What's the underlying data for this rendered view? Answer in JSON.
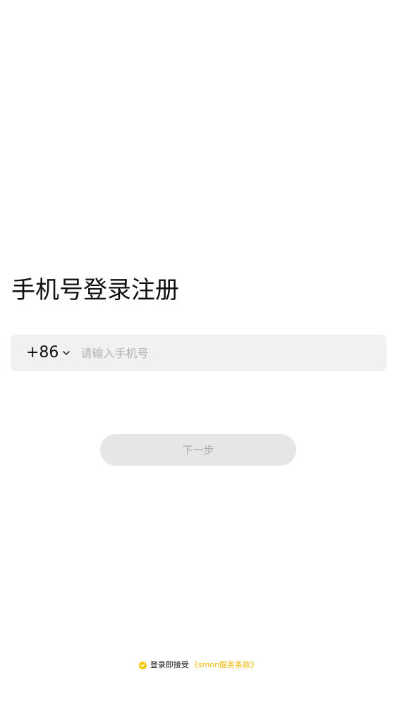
{
  "page": {
    "title": "手机号登录注册"
  },
  "phone": {
    "country_code": "+86",
    "chevron_icon": "chevron-down-icon",
    "placeholder": "请输入手机号",
    "value": ""
  },
  "actions": {
    "next_label": "下一步"
  },
  "agreement": {
    "check_icon": "check-circle-icon",
    "prefix": "登录即接受",
    "link_text": "《smon服务条款》",
    "accent_color": "#f2b800"
  },
  "colors": {
    "button_bg": "#e6e6e6",
    "button_text": "#a8a8a8",
    "input_bg": "#f1f1f1",
    "check_bg": "#f7c800"
  }
}
